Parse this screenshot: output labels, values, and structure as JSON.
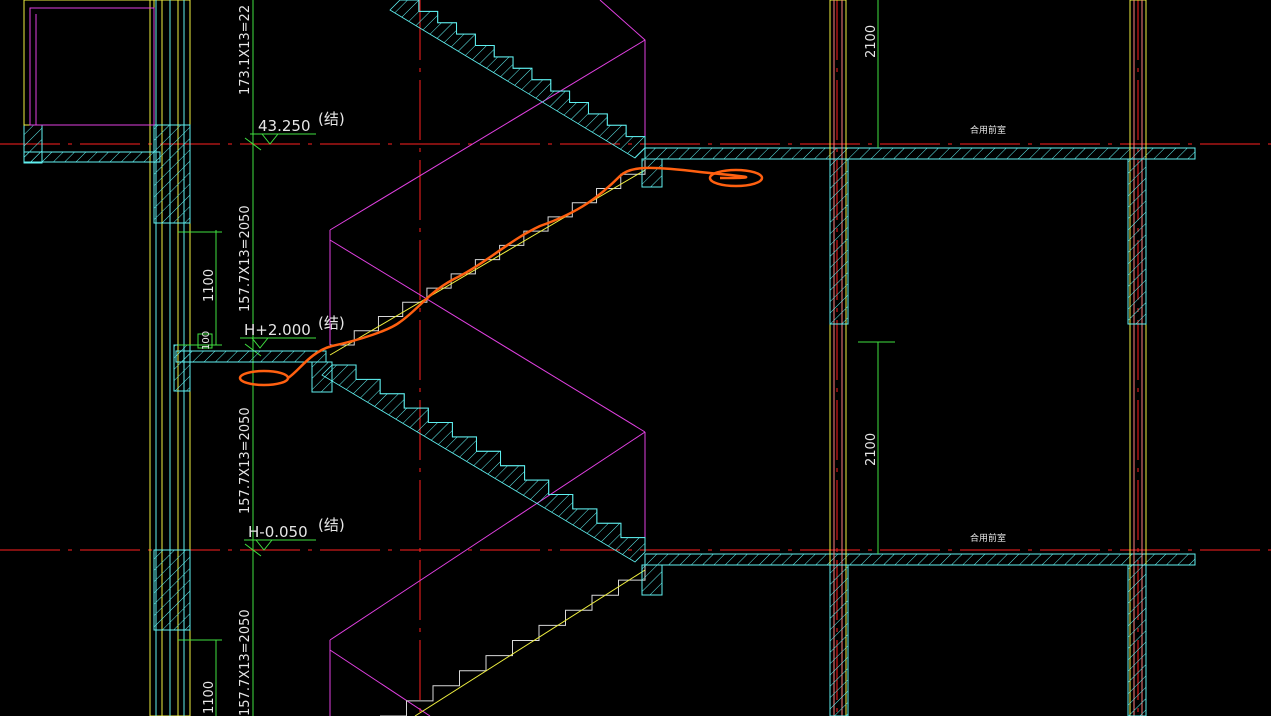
{
  "drawing": {
    "elevations": [
      {
        "id": "top",
        "value": "43.250",
        "note": "(结)"
      },
      {
        "id": "middle",
        "value": "H+2.000",
        "note": "(结)"
      },
      {
        "id": "bottom",
        "value": "H-0.050",
        "note": "(结)"
      }
    ],
    "vertical_dims": [
      {
        "id": "flight1",
        "text": "173.1X13=22"
      },
      {
        "id": "flight2",
        "text": "157.7X13=2050"
      },
      {
        "id": "flight3",
        "text": "157.7X13=2050"
      },
      {
        "id": "flight4",
        "text": "157.7X13=2050"
      }
    ],
    "railing_dims": [
      {
        "id": "rail-upper",
        "text": "1100"
      },
      {
        "id": "rail-lower",
        "text": "1100"
      },
      {
        "id": "rail-small",
        "text": "100"
      }
    ],
    "room_dims": [
      {
        "id": "room-upper",
        "text": "2100"
      },
      {
        "id": "room-lower",
        "text": "2100"
      }
    ],
    "room_labels": [
      {
        "id": "room-label-upper",
        "text": "合用前室"
      },
      {
        "id": "room-label-lower",
        "text": "合用前室"
      }
    ],
    "colors": {
      "background": "#000000",
      "wall_cyan": "#5ff0f0",
      "axis_red": "#ff2020",
      "magenta": "#e040e0",
      "yellow": "#f0f040",
      "green": "#40e040",
      "orange_markup": "#ff6010",
      "text": "#e6e6e6"
    }
  }
}
